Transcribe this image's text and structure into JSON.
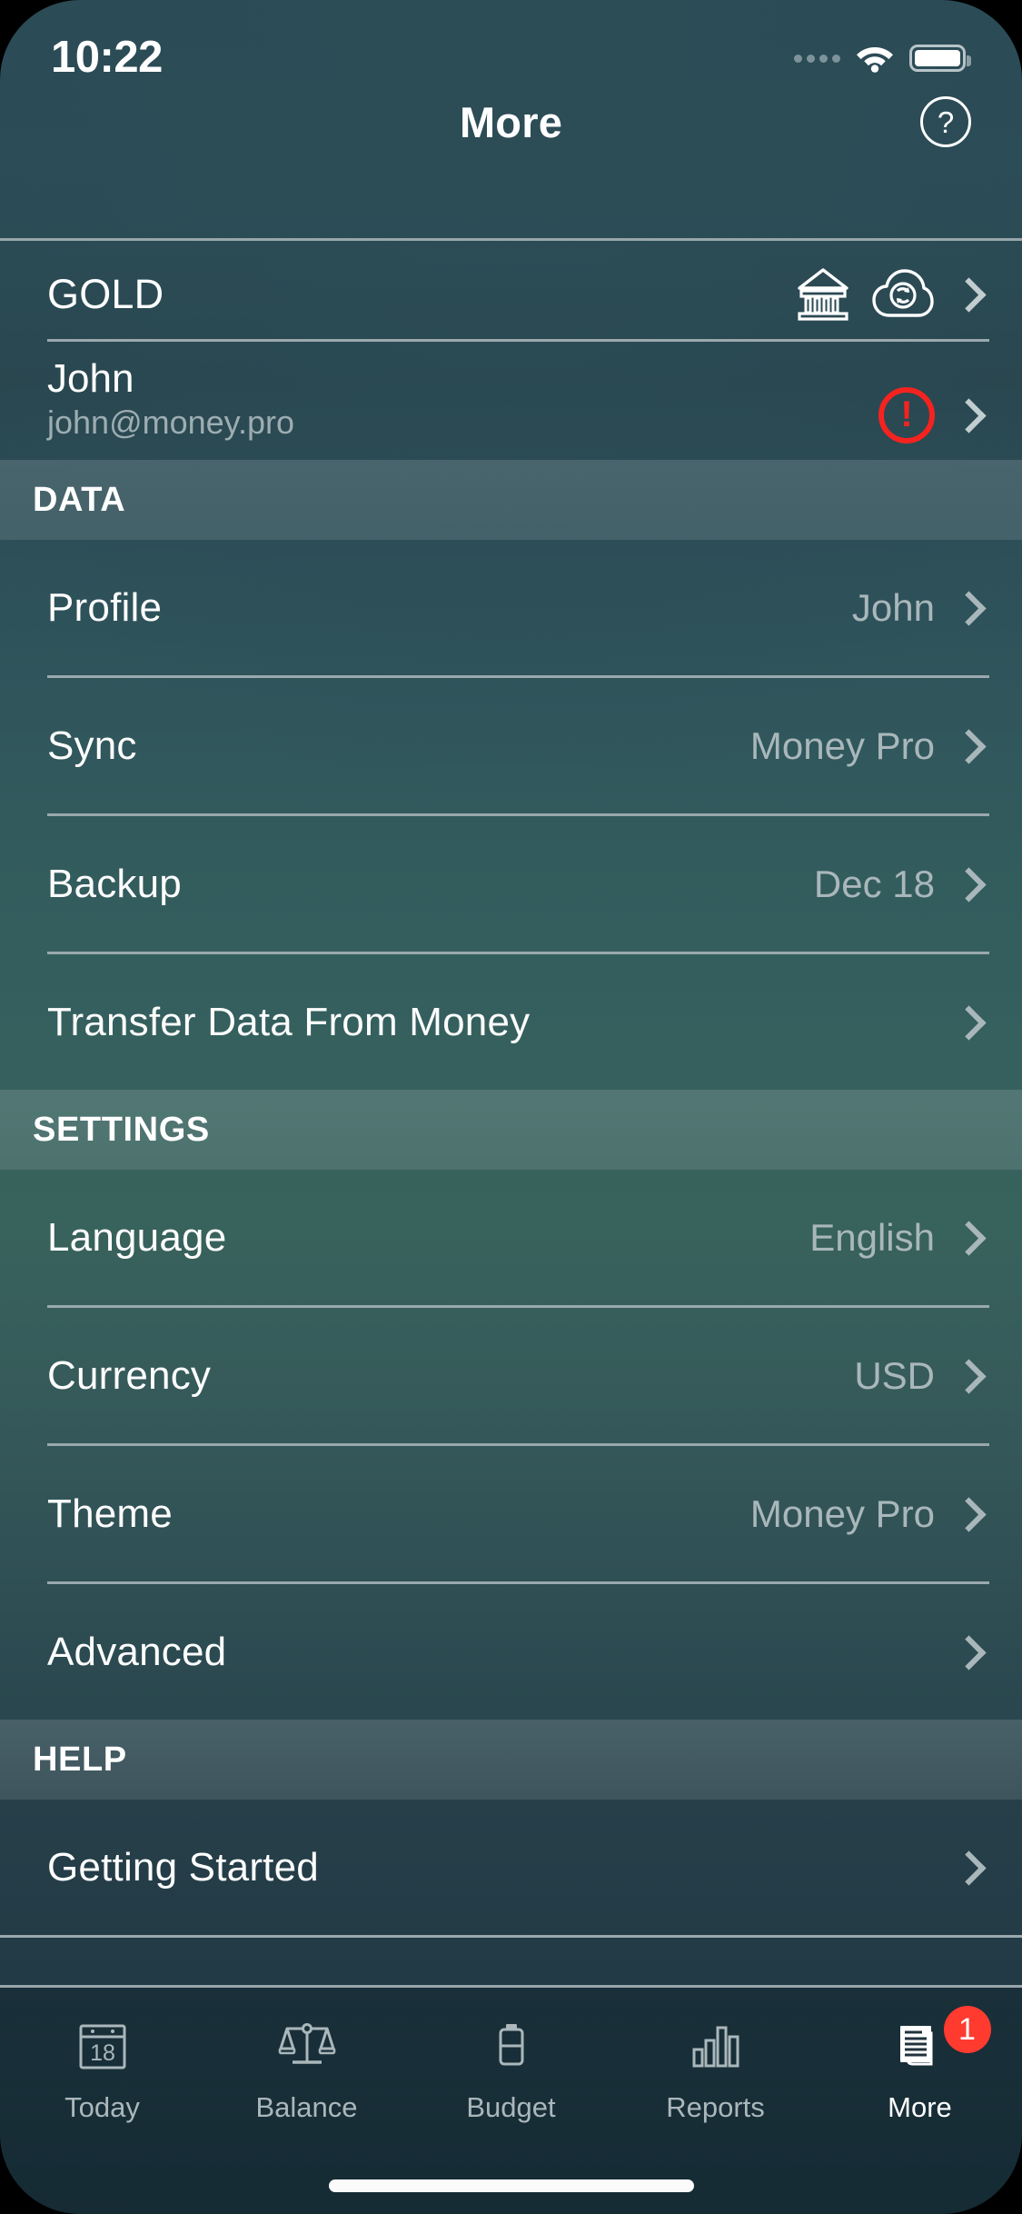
{
  "status_bar": {
    "time": "10:22",
    "signal_icon": "signal-dots-icon",
    "wifi_icon": "wifi-icon",
    "battery_icon": "battery-icon"
  },
  "nav": {
    "title": "More",
    "help_label": "?"
  },
  "account": {
    "plan_label": "GOLD",
    "bank_icon": "bank-icon",
    "cloud_sync_icon": "cloud-sync-icon",
    "user_name": "John",
    "user_email": "john@money.pro",
    "alert_symbol": "!",
    "alert_color": "#f5231f"
  },
  "sections": [
    {
      "header": "DATA",
      "rows": [
        {
          "label": "Profile",
          "value": "John"
        },
        {
          "label": "Sync",
          "value": "Money Pro"
        },
        {
          "label": "Backup",
          "value": "Dec 18"
        },
        {
          "label": "Transfer Data From Money",
          "value": ""
        }
      ]
    },
    {
      "header": "SETTINGS",
      "rows": [
        {
          "label": "Language",
          "value": "English"
        },
        {
          "label": "Currency",
          "value": "USD"
        },
        {
          "label": "Theme",
          "value": "Money Pro"
        },
        {
          "label": "Advanced",
          "value": ""
        }
      ]
    },
    {
      "header": "HELP",
      "rows": [
        {
          "label": "Getting Started",
          "value": ""
        }
      ]
    }
  ],
  "tabbar": {
    "items": [
      {
        "label": "Today",
        "icon": "calendar-icon",
        "day": "18",
        "active": false
      },
      {
        "label": "Balance",
        "icon": "scales-icon",
        "active": false
      },
      {
        "label": "Budget",
        "icon": "battery-budget-icon",
        "active": false
      },
      {
        "label": "Reports",
        "icon": "bar-chart-icon",
        "active": false
      },
      {
        "label": "More",
        "icon": "documents-icon",
        "active": true,
        "badge": "1"
      }
    ],
    "badge_color": "#ff3b30"
  }
}
